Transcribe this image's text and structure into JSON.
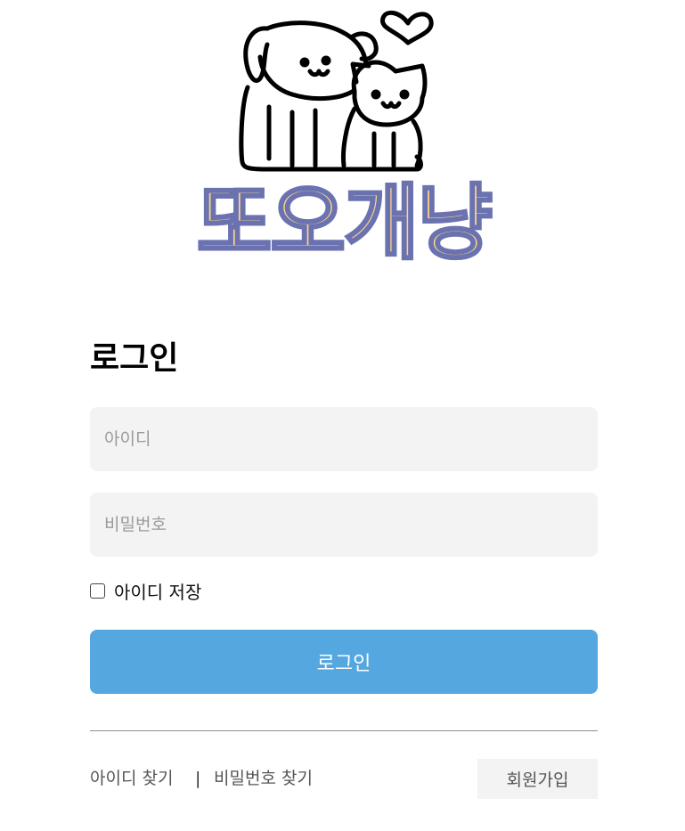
{
  "logo": {
    "wordmark": "또오개냥",
    "wordmark_fill": "#ffd489",
    "wordmark_stroke": "#6b72b0",
    "icon": "dog-and-cat-with-heart-icon"
  },
  "login": {
    "title": "로그인",
    "id_placeholder": "아이디",
    "password_placeholder": "비밀번호",
    "save_id_label": "아이디 저장",
    "save_id_checked": false,
    "submit_label": "로그인",
    "accent_color": "#54a7df"
  },
  "footer": {
    "find_id_label": "아이디 찾기",
    "separator": "|",
    "find_password_label": "비밀번호 찾기",
    "signup_label": "회원가입"
  }
}
